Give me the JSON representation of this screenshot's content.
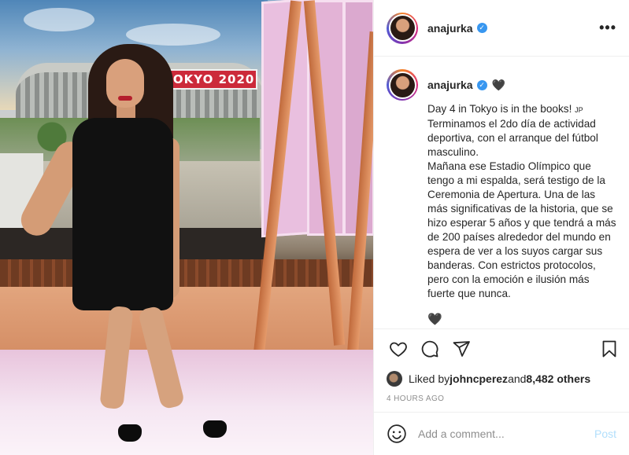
{
  "post": {
    "username": "anajurka",
    "verified_icon": "verified-badge-icon",
    "photo": {
      "stadium_sign": "TOKYO 2020"
    }
  },
  "caption": {
    "username": "anajurka",
    "tag": "JP",
    "first_line": "Day 4 in Tokyo is in the books! ",
    "body": "Terminamos el 2do día de actividad deportiva, con el arranque del fútbol masculino.\nMañana ese Estadio Olímpico que tengo a mi espalda, será testigo de la Ceremonia de Apertura. Una de las más significativas de la historia, que se hizo esperar 5 años y que tendrá a más de 200 países alrededor del mundo en espera de ver a los suyos cargar sus banderas. Con estrictos protocolos, pero con la emoción e ilusión más fuerte que nunca."
  },
  "likes": {
    "prefix": "Liked by ",
    "user": "johncperez",
    "middle": " and ",
    "count": "8,482 others"
  },
  "timestamp": "4 HOURS AGO",
  "comment_box": {
    "placeholder": "Add a comment...",
    "post_label": "Post"
  },
  "colors": {
    "verified": "#3897f0",
    "post_disabled": "#b2dffc",
    "muted": "#8e8e8e"
  }
}
